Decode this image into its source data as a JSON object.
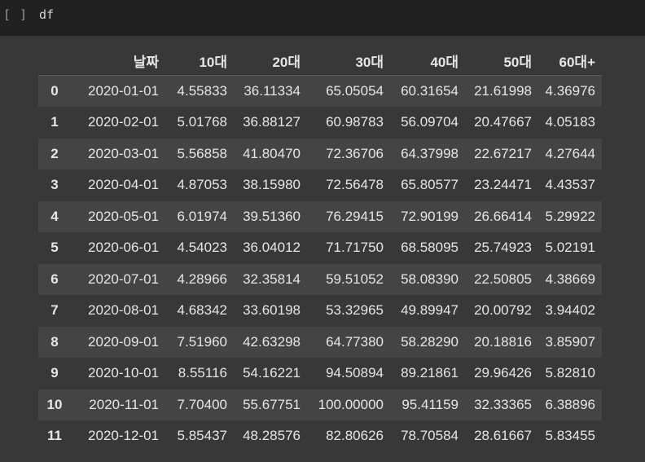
{
  "cell": {
    "prompt": "[ ]",
    "code": "df"
  },
  "table": {
    "columns": [
      "",
      "날짜",
      "10대",
      "20대",
      "30대",
      "40대",
      "50대",
      "60대+"
    ],
    "rows": [
      [
        "0",
        "2020-01-01",
        "4.55833",
        "36.11334",
        "65.05054",
        "60.31654",
        "21.61998",
        "4.36976"
      ],
      [
        "1",
        "2020-02-01",
        "5.01768",
        "36.88127",
        "60.98783",
        "56.09704",
        "20.47667",
        "4.05183"
      ],
      [
        "2",
        "2020-03-01",
        "5.56858",
        "41.80470",
        "72.36706",
        "64.37998",
        "22.67217",
        "4.27644"
      ],
      [
        "3",
        "2020-04-01",
        "4.87053",
        "38.15980",
        "72.56478",
        "65.80577",
        "23.24471",
        "4.43537"
      ],
      [
        "4",
        "2020-05-01",
        "6.01974",
        "39.51360",
        "76.29415",
        "72.90199",
        "26.66414",
        "5.29922"
      ],
      [
        "5",
        "2020-06-01",
        "4.54023",
        "36.04012",
        "71.71750",
        "68.58095",
        "25.74923",
        "5.02191"
      ],
      [
        "6",
        "2020-07-01",
        "4.28966",
        "32.35814",
        "59.51052",
        "58.08390",
        "22.50805",
        "4.38669"
      ],
      [
        "7",
        "2020-08-01",
        "4.68342",
        "33.60198",
        "53.32965",
        "49.89947",
        "20.00792",
        "3.94402"
      ],
      [
        "8",
        "2020-09-01",
        "7.51960",
        "42.63298",
        "64.77380",
        "58.28290",
        "20.18816",
        "3.85907"
      ],
      [
        "9",
        "2020-10-01",
        "8.55116",
        "54.16221",
        "94.50894",
        "89.21861",
        "29.96426",
        "5.82810"
      ],
      [
        "10",
        "2020-11-01",
        "7.70400",
        "55.67751",
        "100.00000",
        "95.41159",
        "32.33365",
        "6.38896"
      ],
      [
        "11",
        "2020-12-01",
        "5.85437",
        "48.28576",
        "82.80626",
        "78.70584",
        "28.61667",
        "5.83455"
      ]
    ]
  }
}
